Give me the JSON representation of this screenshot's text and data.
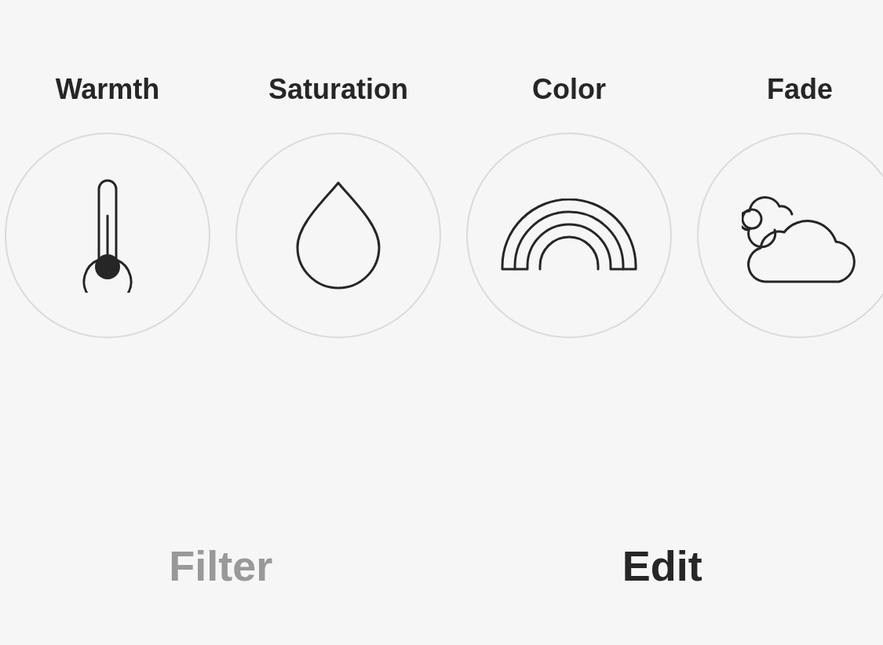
{
  "tools": [
    {
      "label": "Warmth",
      "kind": "thermometer"
    },
    {
      "label": "Saturation",
      "kind": "drop"
    },
    {
      "label": "Color",
      "kind": "rainbow"
    },
    {
      "label": "Fade",
      "kind": "clouds"
    }
  ],
  "tabs": [
    {
      "label": "Filter",
      "selected": false
    },
    {
      "label": "Edit",
      "selected": true
    }
  ]
}
